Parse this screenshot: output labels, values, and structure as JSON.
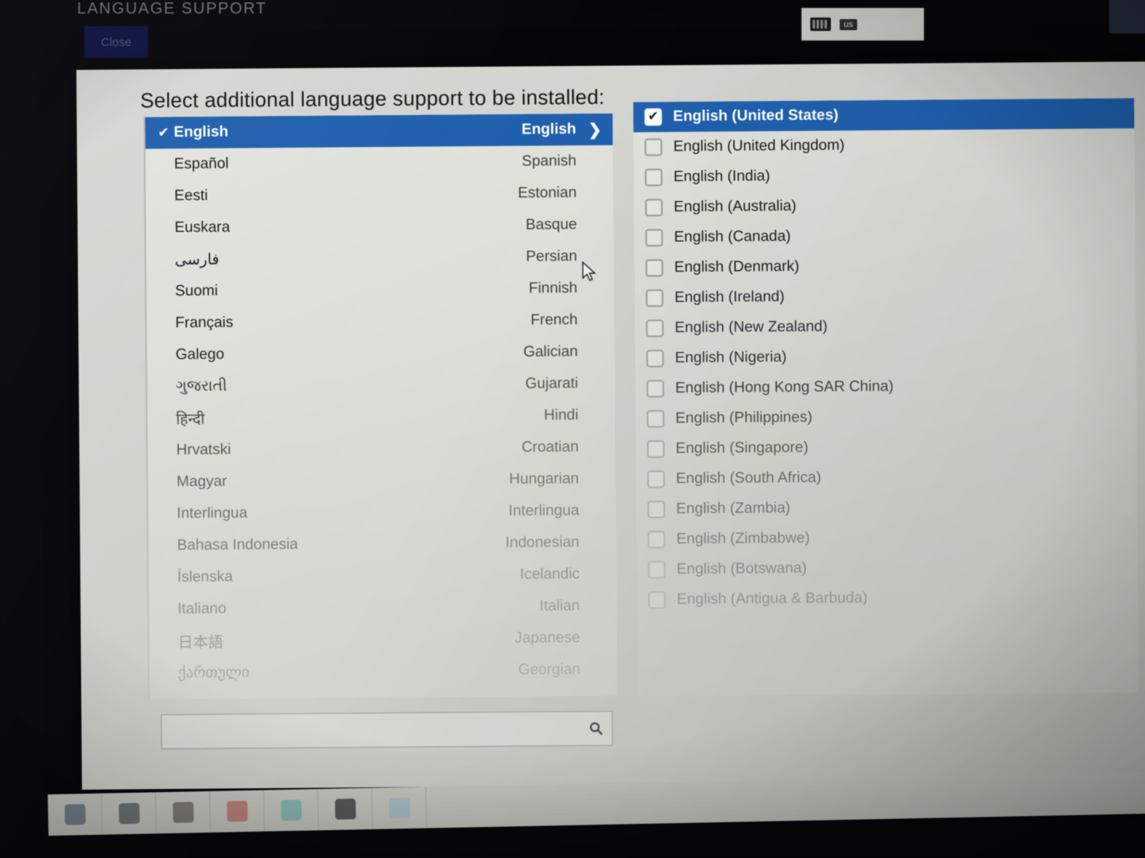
{
  "app": {
    "title": "LANGUAGE SUPPORT",
    "close_label": "Close"
  },
  "tray": {
    "keyboard_icon": "keyboard-icon",
    "layout_label": "us"
  },
  "dialog": {
    "heading": "Select additional language support to be installed:"
  },
  "search": {
    "value": "",
    "placeholder": "",
    "icon": "search-icon"
  },
  "language_list": {
    "selected_index": 0,
    "check_glyph": "✔",
    "chevron_glyph": "❯",
    "items": [
      {
        "native": "English",
        "english": "English"
      },
      {
        "native": "Español",
        "english": "Spanish"
      },
      {
        "native": "Eesti",
        "english": "Estonian"
      },
      {
        "native": "Euskara",
        "english": "Basque"
      },
      {
        "native": "فارسی",
        "english": "Persian"
      },
      {
        "native": "Suomi",
        "english": "Finnish"
      },
      {
        "native": "Français",
        "english": "French"
      },
      {
        "native": "Galego",
        "english": "Galician"
      },
      {
        "native": "ગુજરાતી",
        "english": "Gujarati"
      },
      {
        "native": "हिन्दी",
        "english": "Hindi"
      },
      {
        "native": "Hrvatski",
        "english": "Croatian"
      },
      {
        "native": "Magyar",
        "english": "Hungarian"
      },
      {
        "native": "Interlingua",
        "english": "Interlingua"
      },
      {
        "native": "Bahasa Indonesia",
        "english": "Indonesian"
      },
      {
        "native": "Íslenska",
        "english": "Icelandic"
      },
      {
        "native": "Italiano",
        "english": "Italian"
      },
      {
        "native": "日本語",
        "english": "Japanese"
      },
      {
        "native": "ქართული",
        "english": "Georgian"
      }
    ]
  },
  "locale_list": {
    "selected_index": 0,
    "items": [
      {
        "label": "English (United States)",
        "checked": true
      },
      {
        "label": "English (United Kingdom)",
        "checked": false
      },
      {
        "label": "English (India)",
        "checked": false
      },
      {
        "label": "English (Australia)",
        "checked": false
      },
      {
        "label": "English (Canada)",
        "checked": false
      },
      {
        "label": "English (Denmark)",
        "checked": false
      },
      {
        "label": "English (Ireland)",
        "checked": false
      },
      {
        "label": "English (New Zealand)",
        "checked": false
      },
      {
        "label": "English (Nigeria)",
        "checked": false
      },
      {
        "label": "English (Hong Kong SAR China)",
        "checked": false
      },
      {
        "label": "English (Philippines)",
        "checked": false
      },
      {
        "label": "English (Singapore)",
        "checked": false
      },
      {
        "label": "English (South Africa)",
        "checked": false
      },
      {
        "label": "English (Zambia)",
        "checked": false
      },
      {
        "label": "English (Zimbabwe)",
        "checked": false
      },
      {
        "label": "English (Botswana)",
        "checked": false
      },
      {
        "label": "English (Antigua & Barbuda)",
        "checked": false
      }
    ]
  },
  "dock": {
    "items": [
      {
        "name": "app-icon-1",
        "color": "#3f566b"
      },
      {
        "name": "app-icon-2",
        "color": "#3a3f44"
      },
      {
        "name": "app-icon-3",
        "color": "#4e4a45"
      },
      {
        "name": "app-icon-4",
        "color": "#b0564f"
      },
      {
        "name": "app-icon-5",
        "color": "#63a9ad"
      },
      {
        "name": "app-icon-6",
        "color": "#17171a"
      },
      {
        "name": "app-icon-7",
        "color": "#8fb6c9"
      }
    ]
  },
  "colors": {
    "accent_blue": "#2060ae",
    "panel_gray": "#d6d6d0",
    "close_button_blue": "#17207a"
  }
}
